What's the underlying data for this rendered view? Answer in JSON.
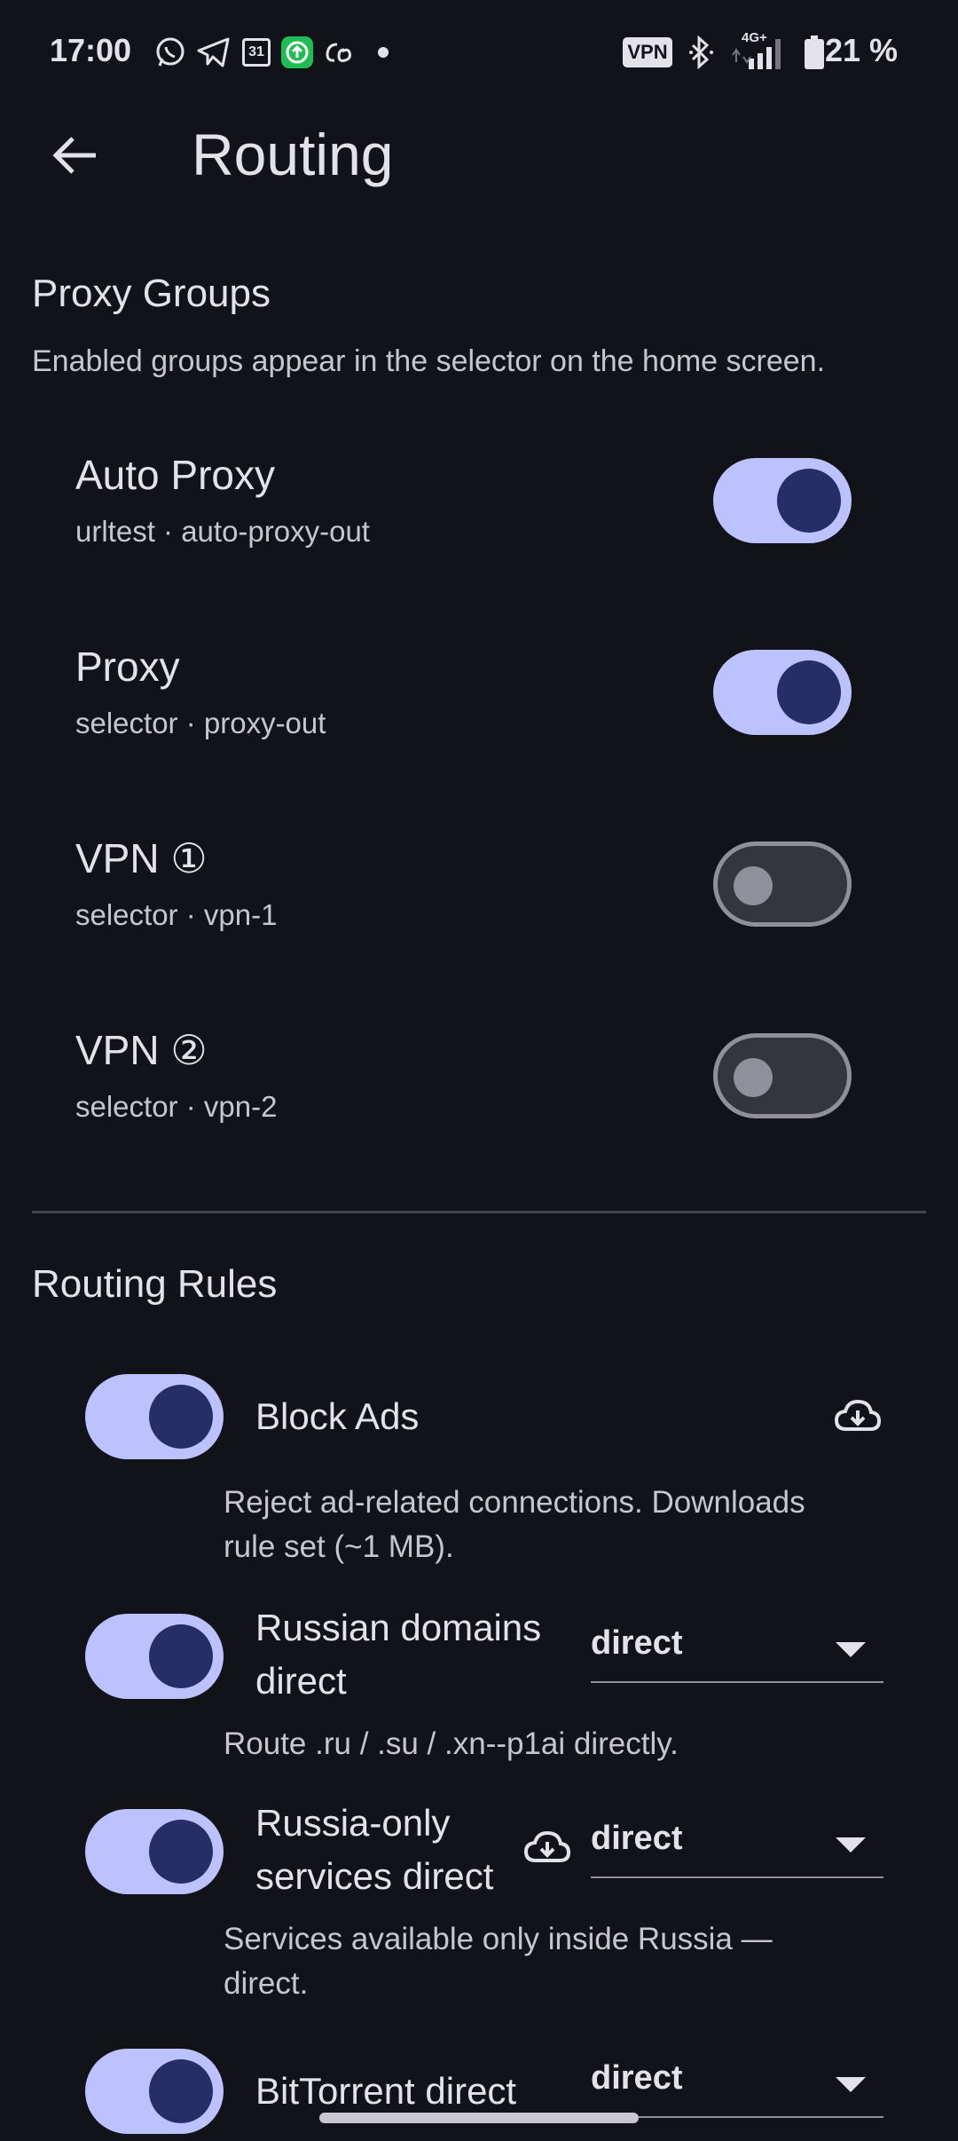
{
  "status_bar": {
    "time": "17:00",
    "battery": "21 %",
    "vpn_badge": "VPN",
    "network": "4G+",
    "calendar_day": "31",
    "icons": [
      "whatsapp-icon",
      "telegram-icon",
      "calendar-icon",
      "upload-icon",
      "script-icon",
      "dot-icon",
      "vpn-icon",
      "bluetooth-icon",
      "signal-icon",
      "battery-icon"
    ]
  },
  "app_bar": {
    "title": "Routing"
  },
  "proxy_groups": {
    "title": "Proxy Groups",
    "subtitle": "Enabled groups appear in the selector on the home screen.",
    "items": [
      {
        "name": "Auto Proxy",
        "detail": "urltest · auto-proxy-out",
        "enabled": true
      },
      {
        "name": "Proxy",
        "detail": "selector · proxy-out",
        "enabled": true
      },
      {
        "name": "VPN ①",
        "detail": "selector · vpn-1",
        "enabled": false
      },
      {
        "name": "VPN ②",
        "detail": "selector · vpn-2",
        "enabled": false
      }
    ]
  },
  "routing_rules": {
    "title": "Routing Rules",
    "items": [
      {
        "title": "Block Ads",
        "desc_line1": "Reject ad-related connections. Downloads",
        "desc_line2": "rule set (~1 MB).",
        "enabled": true,
        "download_icon": true
      },
      {
        "title_line1": "Russian domains",
        "title_line2": "direct",
        "desc": "Route .ru / .su / .xn--p1ai directly.",
        "value": "direct",
        "enabled": true
      },
      {
        "title_line1": "Russia-only",
        "title_line2": "services direct",
        "desc_line1": "Services available only inside Russia —",
        "desc_line2": "direct.",
        "value": "direct",
        "enabled": true,
        "download_icon": true
      },
      {
        "title": "BitTorrent direct",
        "value": "direct",
        "enabled": true
      }
    ]
  }
}
